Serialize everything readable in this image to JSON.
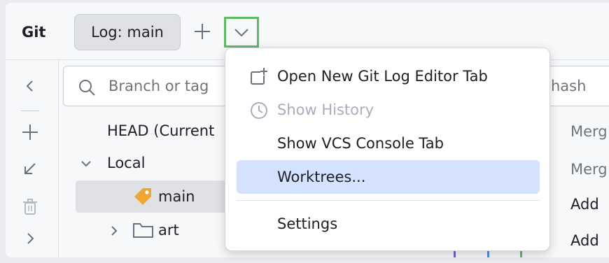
{
  "header": {
    "title": "Git",
    "log_tab_label": "Log: main"
  },
  "left_toolbar": {
    "icons": [
      "chevron-left-icon",
      "plus-icon",
      "arrow-down-left-icon",
      "trash-icon",
      "chevron-right-icon"
    ]
  },
  "search": {
    "placeholder": "Branch or tag"
  },
  "tree": {
    "head_label": "HEAD (Current",
    "local_label": "Local",
    "main_label": "main",
    "art_label": "art"
  },
  "log": {
    "filter_hint": "hash",
    "messages": [
      "Merg",
      "Merg",
      "Add",
      "Add"
    ]
  },
  "menu": {
    "items": [
      {
        "label": "Open New Git Log Editor Tab",
        "icon": "new-tab-icon",
        "enabled": true
      },
      {
        "label": "Show History",
        "icon": "clock-icon",
        "enabled": false
      },
      {
        "label": "Show VCS Console Tab",
        "enabled": true
      },
      {
        "label": "Worktrees...",
        "enabled": true,
        "highlighted": true
      },
      {
        "label": "Settings",
        "enabled": true
      }
    ]
  },
  "colors": {
    "highlight": "#d4e2ff",
    "focus_outline": "#5fb865",
    "tag_icon": "#f0a732"
  }
}
